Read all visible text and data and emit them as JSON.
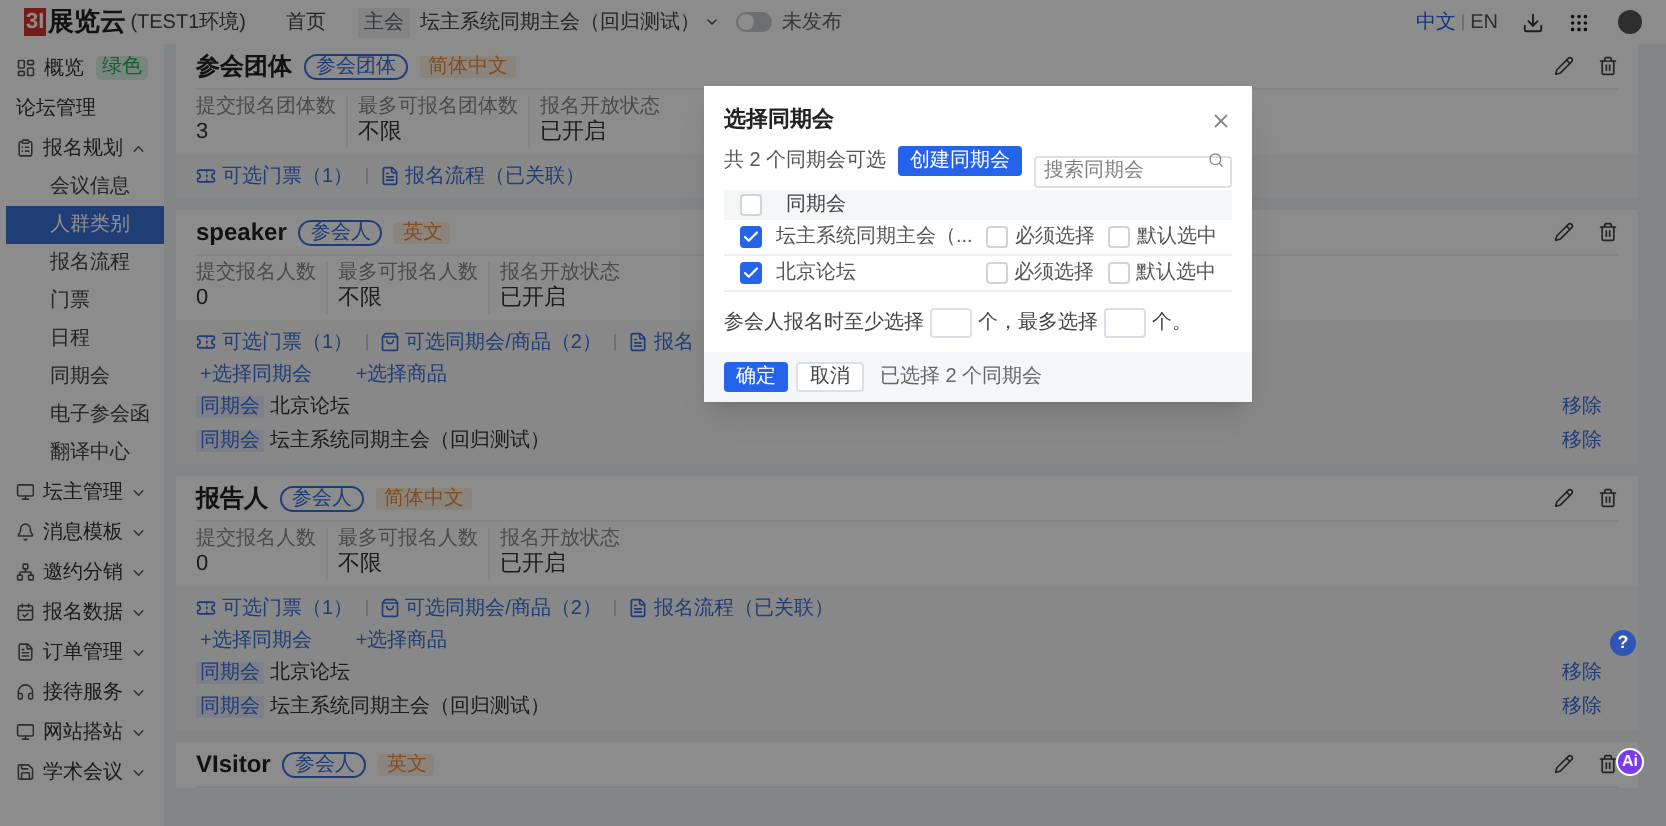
{
  "header": {
    "logo_mark": "3I",
    "logo_text": "展览云",
    "env": "(TEST1环境)",
    "home": "首页",
    "event_tag": "主会",
    "event_name": "坛主系统同期主会（回归测试）",
    "publish": {
      "on": false,
      "label": "未发布"
    },
    "languages": [
      {
        "label": "中文",
        "selected": true
      },
      {
        "label": "EN",
        "selected": false
      }
    ]
  },
  "sidebar": {
    "items": [
      {
        "label": "概览",
        "badge": "绿色",
        "kind": "top"
      },
      {
        "label": "论坛管理",
        "kind": "plain"
      },
      {
        "label": "报名规划",
        "kind": "top",
        "expanded": true,
        "children": [
          {
            "label": "会议信息",
            "selected": false
          },
          {
            "label": "人群类别",
            "selected": true
          },
          {
            "label": "报名流程",
            "selected": false
          },
          {
            "label": "门票",
            "selected": false
          },
          {
            "label": "日程",
            "selected": false
          },
          {
            "label": "同期会",
            "selected": false
          },
          {
            "label": "电子参会函",
            "selected": false
          },
          {
            "label": "翻译中心",
            "selected": false
          }
        ]
      },
      {
        "label": "坛主管理",
        "kind": "top",
        "expanded": false
      },
      {
        "label": "消息模板",
        "kind": "top",
        "expanded": false
      },
      {
        "label": "邀约分销",
        "kind": "top",
        "expanded": false
      },
      {
        "label": "报名数据",
        "kind": "top",
        "expanded": false
      },
      {
        "label": "订单管理",
        "kind": "top",
        "expanded": false
      },
      {
        "label": "接待服务",
        "kind": "top",
        "expanded": false
      },
      {
        "label": "网站搭站",
        "kind": "top",
        "expanded": false
      },
      {
        "label": "学术会议",
        "kind": "top",
        "expanded": false
      }
    ]
  },
  "cards": [
    {
      "title": "参会团体",
      "type_tag": "参会团体",
      "lang_tag": "简体中文",
      "stats": [
        {
          "label": "提交报名团体数",
          "value": "3"
        },
        {
          "label": "最多可报名团体数",
          "value": "不限"
        },
        {
          "label": "报名开放状态",
          "value": "已开启"
        }
      ],
      "links": [
        {
          "kind": "ticket",
          "text": "可选门票（1）"
        },
        {
          "kind": "flow",
          "text": "报名流程（已关联）"
        }
      ]
    },
    {
      "title": "speaker",
      "type_tag": "参会人",
      "lang_tag": "英文",
      "stats": [
        {
          "label": "提交报名人数",
          "value": "0"
        },
        {
          "label": "最多可报名人数",
          "value": "不限"
        },
        {
          "label": "报名开放状态",
          "value": "已开启"
        }
      ],
      "links": [
        {
          "kind": "ticket",
          "text": "可选门票（1）"
        },
        {
          "kind": "goods",
          "text": "可选同期会/商品（2）"
        },
        {
          "kind": "flow",
          "text": "报名"
        }
      ],
      "adders": [
        "+选择同期会",
        "+选择商品"
      ],
      "items": [
        {
          "tag": "同期会",
          "name": "北京论坛",
          "action": "移除"
        },
        {
          "tag": "同期会",
          "name": "坛主系统同期主会（回归测试）",
          "action": "移除"
        }
      ]
    },
    {
      "title": "报告人",
      "type_tag": "参会人",
      "lang_tag": "简体中文",
      "stats": [
        {
          "label": "提交报名人数",
          "value": "0"
        },
        {
          "label": "最多可报名人数",
          "value": "不限"
        },
        {
          "label": "报名开放状态",
          "value": "已开启"
        }
      ],
      "links": [
        {
          "kind": "ticket",
          "text": "可选门票（1）"
        },
        {
          "kind": "goods",
          "text": "可选同期会/商品（2）"
        },
        {
          "kind": "flow",
          "text": "报名流程（已关联）"
        }
      ],
      "adders": [
        "+选择同期会",
        "+选择商品"
      ],
      "items": [
        {
          "tag": "同期会",
          "name": "北京论坛",
          "action": "移除"
        },
        {
          "tag": "同期会",
          "name": "坛主系统同期主会（回归测试）",
          "action": "移除"
        }
      ]
    },
    {
      "title": "VIsitor",
      "type_tag": "参会人",
      "lang_tag": "英文"
    }
  ],
  "dialog": {
    "title": "选择同期会",
    "count": "共 2 个同期会可选",
    "create_button": "创建同期会",
    "search": {
      "placeholder": "搜索同期会"
    },
    "column": "同期会",
    "header_checked": false,
    "rows": [
      {
        "name": "坛主系统同期主会（...",
        "checked": true,
        "required": {
          "label": "必须选择",
          "checked": false
        },
        "default": {
          "label": "默认选中",
          "checked": false
        }
      },
      {
        "name": "北京论坛",
        "checked": true,
        "required": {
          "label": "必须选择",
          "checked": false
        },
        "default": {
          "label": "默认选中",
          "checked": false
        }
      }
    ],
    "limit": {
      "before": "参会人报名时至少选择",
      "middle": "个，最多选择",
      "after": "个。"
    },
    "ok": "确定",
    "cancel": "取消",
    "summary": "已选择 2 个同期会"
  },
  "help": "?",
  "ai": "Ai"
}
